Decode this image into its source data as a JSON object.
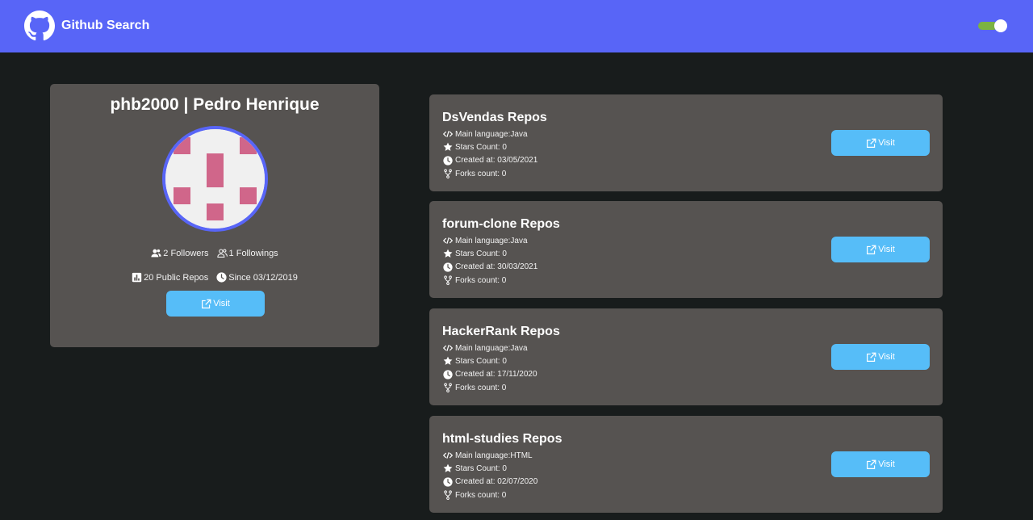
{
  "header": {
    "title": "Github Search",
    "logo_icon": "github-icon",
    "theme_toggle": {
      "state": "on",
      "color": "#7cb342"
    },
    "background": "#5865f7"
  },
  "profile": {
    "name": "phb2000 | Pedro Henrique",
    "avatar_icon": "identicon-avatar",
    "followers": "2 Followers",
    "followings": "1 Followings",
    "public_repos": "20 Public Repos",
    "since": "Since 03/12/2019",
    "visit_label": "Visit"
  },
  "repos": [
    {
      "title": "DsVendas Repos",
      "language": "Main language:Java",
      "stars": "Stars Count: 0",
      "created": "Created at: 03/05/2021",
      "forks": "Forks count: 0",
      "visit_label": "Visit"
    },
    {
      "title": "forum-clone Repos",
      "language": "Main language:Java",
      "stars": "Stars Count: 0",
      "created": "Created at: 30/03/2021",
      "forks": "Forks count: 0",
      "visit_label": "Visit"
    },
    {
      "title": "HackerRank Repos",
      "language": "Main language:Java",
      "stars": "Stars Count: 0",
      "created": "Created at: 17/11/2020",
      "forks": "Forks count: 0",
      "visit_label": "Visit"
    },
    {
      "title": "html-studies Repos",
      "language": "Main language:HTML",
      "stars": "Stars Count: 0",
      "created": "Created at: 02/07/2020",
      "forks": "Forks count: 0",
      "visit_label": "Visit"
    }
  ],
  "colors": {
    "accent": "#5865f7",
    "button": "#56bdf8",
    "card": "#565351",
    "background": "#181c1c",
    "avatar_pink": "#d0668a"
  }
}
